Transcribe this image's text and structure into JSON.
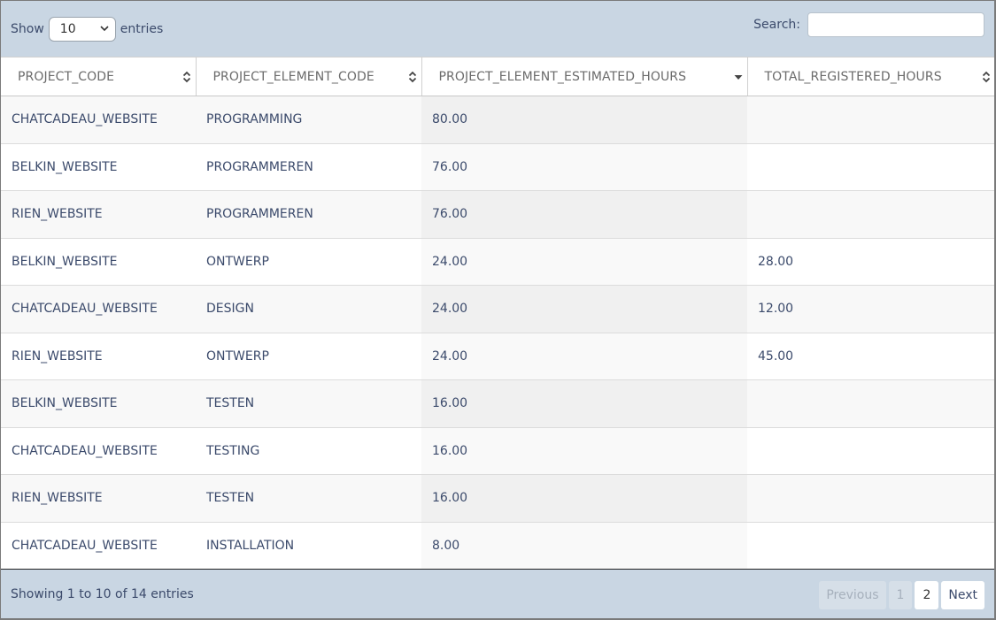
{
  "length_control": {
    "show_label": "Show",
    "selected_value": "10",
    "entries_label": "entries"
  },
  "search": {
    "label": "Search:",
    "value": "",
    "placeholder": ""
  },
  "table": {
    "columns": [
      {
        "label": "PROJECT_CODE",
        "sort_state": "unsorted"
      },
      {
        "label": "PROJECT_ELEMENT_CODE",
        "sort_state": "unsorted"
      },
      {
        "label": "PROJECT_ELEMENT_ESTIMATED_HOURS",
        "sort_state": "descending"
      },
      {
        "label": "TOTAL_REGISTERED_HOURS",
        "sort_state": "unsorted"
      }
    ],
    "rows": [
      [
        "CHATCADEAU_WEBSITE",
        "PROGRAMMING",
        "80.00",
        ""
      ],
      [
        "BELKIN_WEBSITE",
        "PROGRAMMEREN",
        "76.00",
        ""
      ],
      [
        "RIEN_WEBSITE",
        "PROGRAMMEREN",
        "76.00",
        ""
      ],
      [
        "BELKIN_WEBSITE",
        "ONTWERP",
        "24.00",
        "28.00"
      ],
      [
        "CHATCADEAU_WEBSITE",
        "DESIGN",
        "24.00",
        "12.00"
      ],
      [
        "RIEN_WEBSITE",
        "ONTWERP",
        "24.00",
        "45.00"
      ],
      [
        "BELKIN_WEBSITE",
        "TESTEN",
        "16.00",
        ""
      ],
      [
        "CHATCADEAU_WEBSITE",
        "TESTING",
        "16.00",
        ""
      ],
      [
        "RIEN_WEBSITE",
        "TESTEN",
        "16.00",
        ""
      ],
      [
        "CHATCADEAU_WEBSITE",
        "INSTALLATION",
        "8.00",
        ""
      ]
    ]
  },
  "footer": {
    "info": "Showing 1 to 10 of 14 entries",
    "pagination": {
      "previous": "Previous",
      "pages": [
        "1",
        "2"
      ],
      "next": "Next"
    }
  },
  "colors": {
    "toolbar_bg": "#c9d6e3",
    "text": "#3b4a6b",
    "header_text": "#6b6b6b",
    "sorted_col_odd": "#f0f0f0",
    "row_odd": "#f8f8f8",
    "row_even": "#ffffff"
  }
}
